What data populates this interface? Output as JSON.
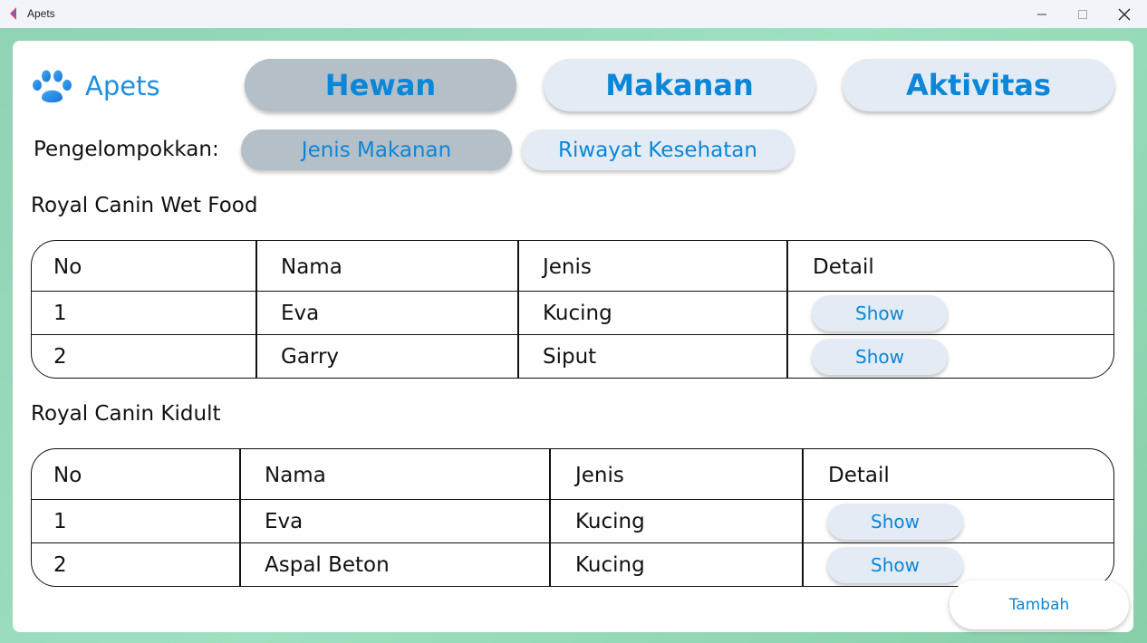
{
  "window": {
    "title": "Apets"
  },
  "app": {
    "name": "Apets",
    "accent_color": "#0b86d9",
    "active_button_color": "#b4bfc7",
    "button_color": "#e3ebf4"
  },
  "nav": {
    "hewan": "Hewan",
    "makanan": "Makanan",
    "aktivitas": "Aktivitas",
    "active": "Hewan"
  },
  "grouping": {
    "label": "Pengelompokkan:",
    "jenis_makanan": "Jenis Makanan",
    "riwayat_kesehatan": "Riwayat Kesehatan",
    "active": "Jenis Makanan"
  },
  "groups": [
    {
      "title": "Royal Canin Wet Food",
      "headers": [
        "No",
        "Nama",
        "Jenis",
        "Detail"
      ],
      "rows": [
        {
          "no": "1",
          "nama": "Eva",
          "jenis": "Kucing",
          "detail": "Show"
        },
        {
          "no": "2",
          "nama": "Garry",
          "jenis": "Siput",
          "detail": "Show"
        }
      ]
    },
    {
      "title": "Royal Canin Kidult",
      "headers": [
        "No",
        "Nama",
        "Jenis",
        "Detail"
      ],
      "rows": [
        {
          "no": "1",
          "nama": "Eva",
          "jenis": "Kucing",
          "detail": "Show"
        },
        {
          "no": "2",
          "nama": "Aspal Beton",
          "jenis": "Kucing",
          "detail": "Show"
        }
      ]
    }
  ],
  "actions": {
    "tambah": "Tambah"
  },
  "icons": {
    "logo": "paw-icon",
    "app": "app-logo-icon",
    "minimize": "minimize-icon",
    "maximize": "maximize-icon",
    "close": "close-icon"
  }
}
